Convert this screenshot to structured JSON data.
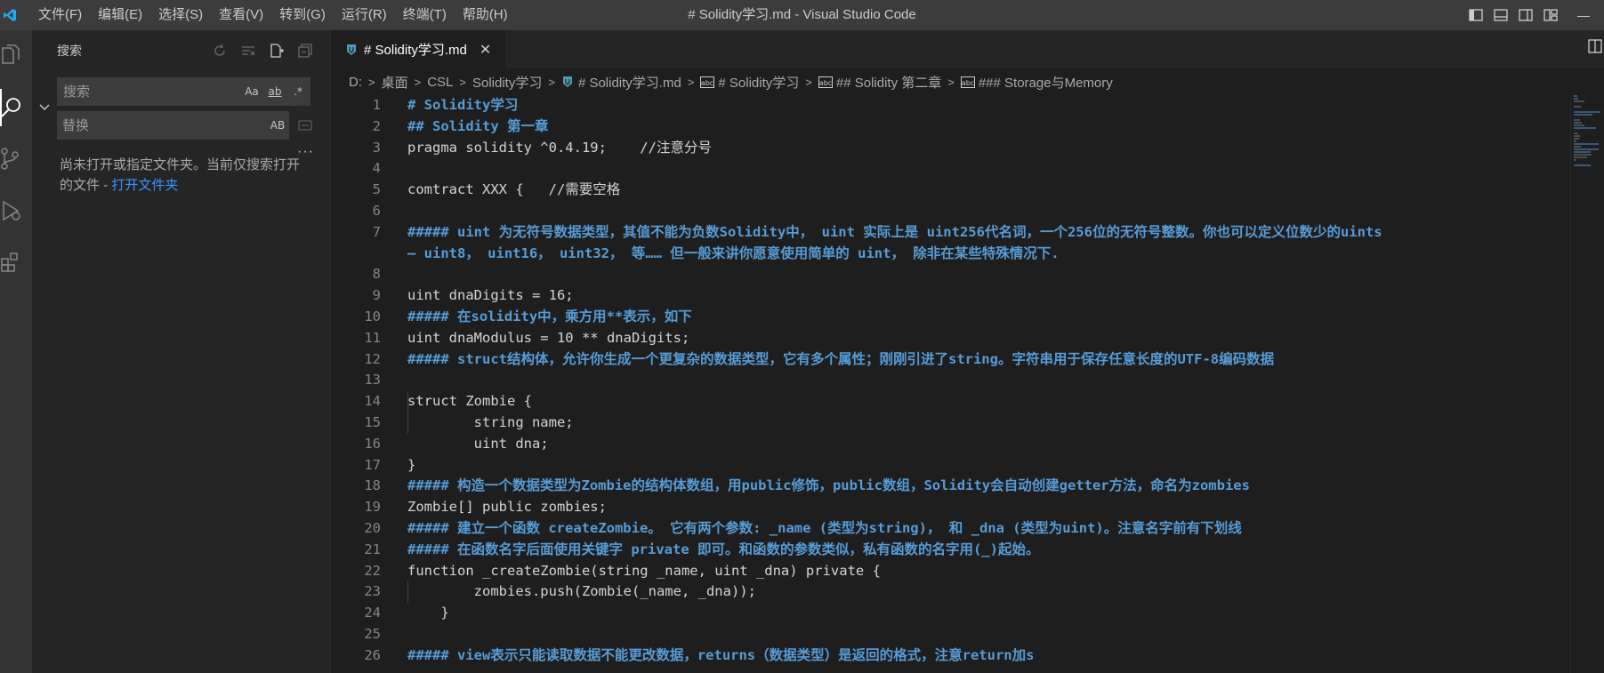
{
  "window": {
    "title": "# Solidity学习.md - Visual Studio Code",
    "minimize_glyph": "—"
  },
  "menu": [
    "文件(F)",
    "编辑(E)",
    "选择(S)",
    "查看(V)",
    "转到(G)",
    "运行(R)",
    "终端(T)",
    "帮助(H)"
  ],
  "activity_bar": [
    "files-icon",
    "search-icon",
    "source-control-icon",
    "run-debug-icon",
    "extensions-icon"
  ],
  "sidebar": {
    "title": "搜索",
    "search_placeholder": "搜索",
    "replace_placeholder": "替换",
    "opt_match_case": "Aa",
    "opt_whole_word": "ab",
    "opt_regex": ".*",
    "opt_preserve_case": "AB",
    "more": "···",
    "message": "尚未打开或指定文件夹。当前仅搜索打开的文件 - ",
    "open_folder_link": "打开文件夹"
  },
  "tab": {
    "label": "# Solidity学习.md",
    "close": "✕"
  },
  "breadcrumb": [
    "D:",
    "桌面",
    "CSL",
    "Solidity学习",
    "# Solidity学习.md",
    "# Solidity学习",
    "## Solidity 第二章",
    "### Storage与Memory"
  ],
  "editor": {
    "lines": [
      {
        "n": "1",
        "t": "# Solidity学习",
        "h": true
      },
      {
        "n": "2",
        "t": "## Solidity 第一章",
        "h": true
      },
      {
        "n": "3",
        "t": "pragma solidity ^0.4.19;    //注意分号",
        "h": false
      },
      {
        "n": "4",
        "t": "",
        "h": false
      },
      {
        "n": "5",
        "t": "comtract XXX {   //需要空格",
        "h": false
      },
      {
        "n": "6",
        "t": "",
        "h": false
      },
      {
        "n": "7",
        "t": "##### uint 为无符号数据类型，其值不能为负数Solidity中， uint 实际上是 uint256代名词，一个256位的无符号整数。你也可以定义位数少的uints",
        "h": true,
        "wrap": "— uint8， uint16， uint32， 等…… 但一般来讲你愿意使用简单的 uint， 除非在某些特殊情况下."
      },
      {
        "n": "8",
        "t": "",
        "h": false
      },
      {
        "n": "9",
        "t": "uint dnaDigits = 16;",
        "h": false
      },
      {
        "n": "10",
        "t": "##### 在solidity中，乘方用**表示，如下",
        "h": true
      },
      {
        "n": "11",
        "t": "uint dnaModulus = 10 ** dnaDigits;",
        "h": false
      },
      {
        "n": "12",
        "t": "##### struct结构体，允许你生成一个更复杂的数据类型，它有多个属性；刚刚引进了string。字符串用于保存任意长度的UTF-8编码数据",
        "h": true
      },
      {
        "n": "13",
        "t": "",
        "h": false
      },
      {
        "n": "14",
        "t": "struct Zombie {",
        "h": false
      },
      {
        "n": "15",
        "t": "        string name;",
        "h": false
      },
      {
        "n": "16",
        "t": "        uint dna;",
        "h": false
      },
      {
        "n": "17",
        "t": "}",
        "h": false
      },
      {
        "n": "18",
        "t": "##### 构造一个数据类型为Zombie的结构体数组，用public修饰，public数组，Solidity会自动创建getter方法，命名为zombies",
        "h": true
      },
      {
        "n": "19",
        "t": "Zombie[] public zombies;",
        "h": false
      },
      {
        "n": "20",
        "t": "##### 建立一个函数 createZombie。 它有两个参数: _name (类型为string)， 和 _dna (类型为uint)。注意名字前有下划线",
        "h": true
      },
      {
        "n": "21",
        "t": "##### 在函数名字后面使用关键字 private 即可。和函数的参数类似，私有函数的名字用(_)起始。",
        "h": true
      },
      {
        "n": "22",
        "t": "function _createZombie(string _name, uint _dna) private {",
        "h": false
      },
      {
        "n": "23",
        "t": "        zombies.push(Zombie(_name, _dna));",
        "h": false
      },
      {
        "n": "24",
        "t": "    }",
        "h": false
      },
      {
        "n": "25",
        "t": "",
        "h": false
      },
      {
        "n": "26",
        "t": "##### view表示只能读取数据不能更改数据，returns（数据类型）是返回的格式，注意return加s",
        "h": true
      }
    ]
  },
  "colors": {
    "heading": "#569cd6",
    "text": "#d4d4d4",
    "line_number": "#858585",
    "link": "#3794ff",
    "accent_logo": "#23a9f2"
  }
}
